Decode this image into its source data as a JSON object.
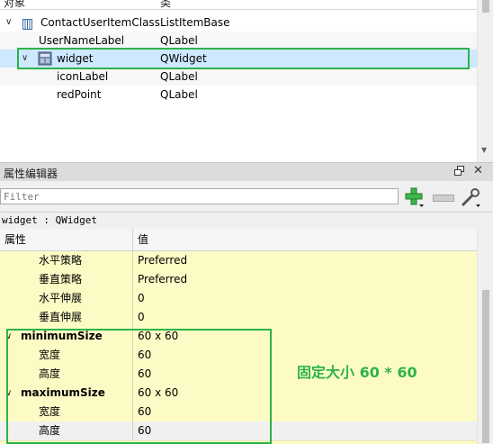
{
  "object_inspector": {
    "header": {
      "col_object": "对象",
      "col_class": "类"
    },
    "rows": [
      {
        "name": "ContactUserItemClass",
        "class": "ListItemBase"
      },
      {
        "name": "UserNameLabel",
        "class": "QLabel"
      },
      {
        "name": "widget",
        "class": "QWidget"
      },
      {
        "name": "iconLabel",
        "class": "QLabel"
      },
      {
        "name": "redPoint",
        "class": "QLabel"
      }
    ]
  },
  "property_editor": {
    "title": "属性编辑器",
    "filter_placeholder": "Filter",
    "class_line": "widget : QWidget",
    "header": {
      "col_property": "属性",
      "col_value": "值"
    },
    "rows": [
      {
        "name": "水平策略",
        "value": "Preferred"
      },
      {
        "name": "垂直策略",
        "value": "Preferred"
      },
      {
        "name": "水平伸展",
        "value": "0"
      },
      {
        "name": "垂直伸展",
        "value": "0"
      },
      {
        "name": "minimumSize",
        "value": "60 x 60"
      },
      {
        "name": "宽度",
        "value": "60"
      },
      {
        "name": "高度",
        "value": "60"
      },
      {
        "name": "maximumSize",
        "value": "60 x 60"
      },
      {
        "name": "宽度",
        "value": "60"
      },
      {
        "name": "高度",
        "value": "60"
      }
    ]
  },
  "annotation": "固定大小 60 * 60",
  "colors": {
    "highlight_green": "#2db34a",
    "selection_blue": "#cde8ff",
    "property_yellow": "#fdfbc5"
  }
}
